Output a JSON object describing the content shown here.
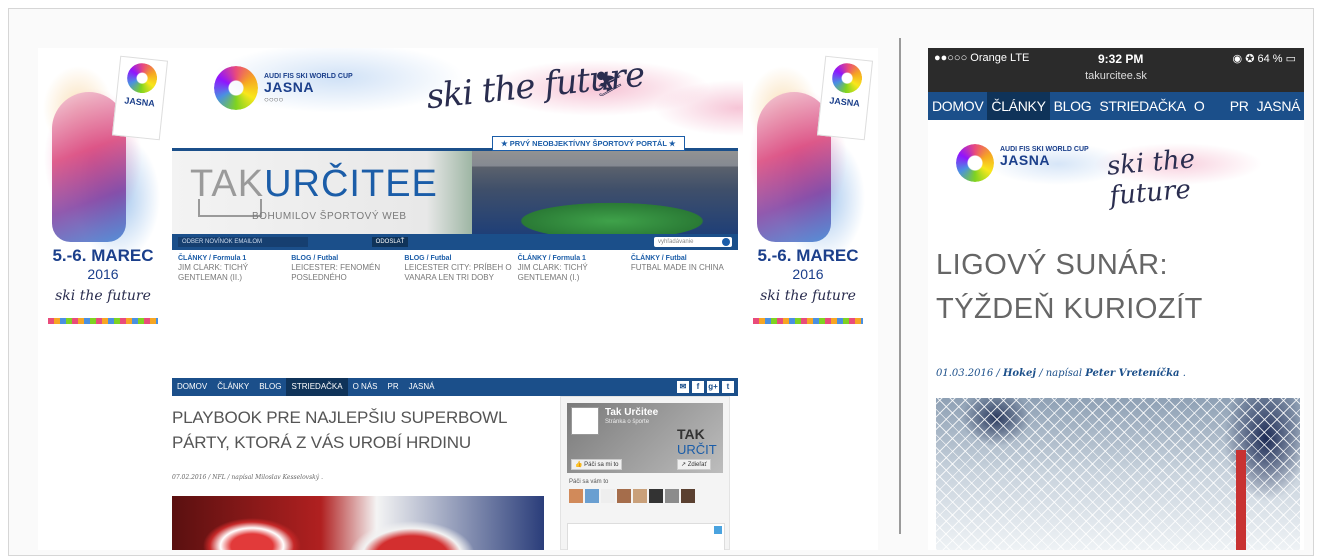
{
  "desktop": {
    "event": {
      "small": "AUDI FIS SKI WORLD CUP",
      "big": "JASNA",
      "rings": "○○○○",
      "slogan": "ski the future",
      "skier_glyph": "⛷"
    },
    "side_banner": {
      "date": "5.-6. MAREC",
      "year": "2016",
      "logo_text": "JASNA",
      "signature": "ski the future"
    },
    "tagline": "★ PRVÝ NEOBJEKTÍVNY ŠPORTOVÝ PORTÁL ★",
    "logo": {
      "part1": "TAK",
      "part2": "URČITEE",
      "sub": "BOHUMILOV ŠPORTOVÝ WEB"
    },
    "newsletter": {
      "placeholder": "ODBER NOVÍNOK EMAILOM",
      "button": "ODOSLAŤ"
    },
    "search": {
      "placeholder": "vyhľadávanie"
    },
    "news": [
      {
        "category": "ČLÁNKY / Formula 1",
        "title": "JIM CLARK: TICHÝ GENTLEMAN (II.)"
      },
      {
        "category": "BLOG / Futbal",
        "title": "LEICESTER: FENOMÉN POSLEDNÉHO"
      },
      {
        "category": "BLOG / Futbal",
        "title": "LEICESTER CITY: PRÍBEH O VANARA LEN TRI DOBY"
      },
      {
        "category": "ČLÁNKY / Formula 1",
        "title": "JIM CLARK: TICHÝ GENTLEMAN (I.)"
      },
      {
        "category": "ČLÁNKY / Futbal",
        "title": "FUTBAL MADE IN CHINA"
      }
    ],
    "nav": [
      {
        "label": "DOMOV"
      },
      {
        "label": "ČLÁNKY"
      },
      {
        "label": "BLOG"
      },
      {
        "label": "STRIEDAČKA"
      },
      {
        "label": "O NÁS"
      },
      {
        "label": "PR"
      },
      {
        "label": "JASNÁ"
      }
    ],
    "social": {
      "mail": "✉",
      "facebook": "f",
      "gplus": "g+",
      "twitter": "t"
    },
    "article": {
      "title": "PLAYBOOK PRE NAJLEPŠIU SUPERBOWL PÁRTY, KTORÁ Z VÁS UROBÍ HRDINU",
      "meta": "07.02.2016 / NFL / napísal Miloslav Kesselovský ."
    },
    "facebook_box": {
      "name": "Tak Určitee",
      "sub": "Stránka o športe",
      "big1": "TAK",
      "big2": "URČIT",
      "like": "👍 Páči sa mi to",
      "share": "↗ Zdieľať",
      "friends_label": "Páči sa vám to"
    }
  },
  "phone": {
    "carrier": "●●○○○ Orange  LTE",
    "time": "9:32 PM",
    "battery": "◉ ✪ 64 % ▭",
    "url": "takurcitee.sk",
    "nav": [
      {
        "label": "DOMOV"
      },
      {
        "label": "ČLÁNKY"
      },
      {
        "label": "BLOG"
      },
      {
        "label": "STRIEDAČKA"
      },
      {
        "label": "O NÁS"
      },
      {
        "label": "PR"
      },
      {
        "label": "JASNÁ"
      }
    ],
    "banner": {
      "small": "AUDI FIS SKI WORLD CUP",
      "big": "JASNA",
      "slogan": "ski the future"
    },
    "article": {
      "title": "LIGOVÝ SUNÁR: TÝŽDEŇ KURIOZÍT",
      "meta_date": "01.03.2016 / ",
      "meta_cat": "Hokej",
      "meta_by": " / napísal ",
      "meta_author": "Peter Vreteníčka",
      "meta_end": " ."
    }
  }
}
